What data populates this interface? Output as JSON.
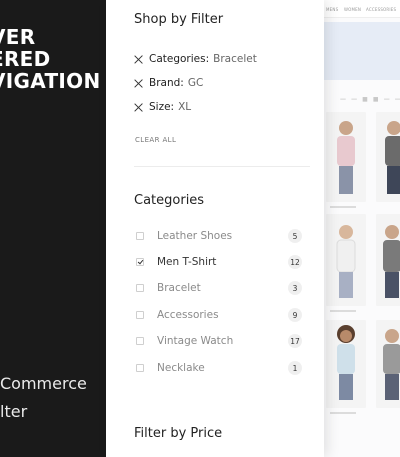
{
  "promo": {
    "title_lines": [
      "VER",
      "ERED",
      "VIGATION"
    ],
    "subtitle_lines": [
      "Commerce",
      "lter"
    ]
  },
  "store": {
    "nav": [
      "MENS",
      "WOMEN",
      "ACCESSORIES"
    ]
  },
  "filter_panel": {
    "title": "Shop by Filter",
    "active_filters": [
      {
        "key": "Categories:",
        "value": "Bracelet"
      },
      {
        "key": "Brand:",
        "value": "GC"
      },
      {
        "key": "Size:",
        "value": "XL"
      }
    ],
    "clear_all": "CLEAR ALL",
    "categories_title": "Categories",
    "categories": [
      {
        "label": "Leather Shoes",
        "count": "5",
        "checked": false
      },
      {
        "label": "Men T-Shirt",
        "count": "12",
        "checked": true
      },
      {
        "label": "Bracelet",
        "count": "3",
        "checked": false
      },
      {
        "label": "Accessories",
        "count": "9",
        "checked": false
      },
      {
        "label": "Vintage Watch",
        "count": "17",
        "checked": false
      },
      {
        "label": "Necklake",
        "count": "1",
        "checked": false
      }
    ],
    "price_title": "Filter by Price"
  },
  "colors": {
    "promo_bg": "#1a1a1a",
    "banner": "#e6ecf6",
    "badge_bg": "#efefef"
  }
}
